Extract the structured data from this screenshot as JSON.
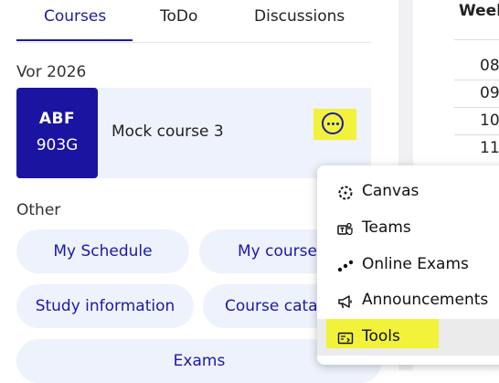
{
  "tabs": [
    {
      "label": "Courses",
      "active": true
    },
    {
      "label": "ToDo",
      "active": false
    },
    {
      "label": "Discussions",
      "active": false
    }
  ],
  "term_heading": "Vor 2026",
  "course": {
    "code_line1": "ABF",
    "code_line2": "903G",
    "name": "Mock course 3",
    "more_icon": "more-horizontal-icon"
  },
  "other_heading": "Other",
  "quick_links": [
    {
      "label": "My Schedule"
    },
    {
      "label": "My course"
    },
    {
      "label": "Study information"
    },
    {
      "label": "Course cata"
    },
    {
      "label": "Exams"
    }
  ],
  "week_panel": {
    "heading": "Week",
    "rows": [
      "08",
      "09",
      "10",
      "11"
    ]
  },
  "context_menu": {
    "items": [
      {
        "label": "Canvas",
        "icon": "canvas-icon"
      },
      {
        "label": "Teams",
        "icon": "teams-icon"
      },
      {
        "label": "Online Exams",
        "icon": "online-exams-icon"
      },
      {
        "label": "Announcements",
        "icon": "megaphone-icon"
      },
      {
        "label": "Tools",
        "icon": "tools-icon",
        "selected": true
      }
    ]
  },
  "colors": {
    "accent": "#1a1aa6",
    "tile": "#1a14a0",
    "highlight": "#f2f23b",
    "card_bg": "#eef2fc"
  }
}
